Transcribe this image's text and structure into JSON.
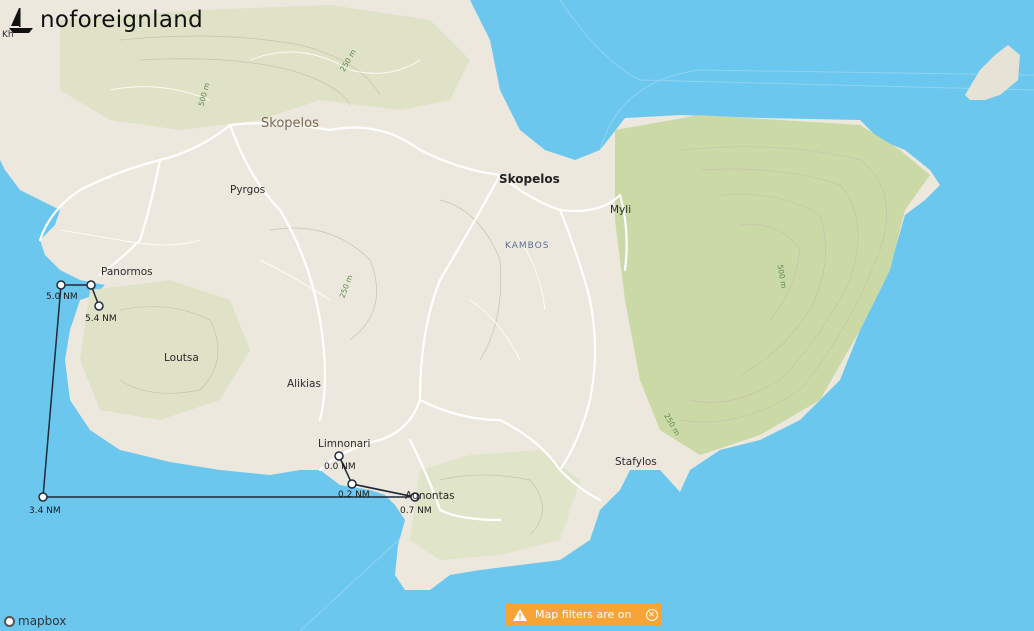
{
  "brand": {
    "name": "noforeignland",
    "partial_label": "Kh"
  },
  "labels": {
    "skopelos_island": "Skopelos",
    "skopelos_town": "Skopelos",
    "kambos": "KAMBOS",
    "mylia": "Myli",
    "pyrgos": "Pyrgos",
    "panormos": "Panormos",
    "loutsa": "Loutsa",
    "alikias": "Alikias",
    "limnonari": "Limnonari",
    "agnontas": "Agnontas",
    "stafylos": "Stafylos"
  },
  "contours": {
    "c1": "250 m",
    "c2": "500 m",
    "c3": "250 m",
    "c4": "500 m",
    "c5": "250 m"
  },
  "route": {
    "distances": {
      "d0": "0.0 NM",
      "d1": "0.2 NM",
      "d2": "0.7 NM",
      "d3": "3.4 NM",
      "d4": "5.0 NM",
      "d5": "5.4 NM"
    }
  },
  "filters_banner": {
    "label": "Map filters are on"
  },
  "attribution": {
    "label": "mapbox"
  },
  "colors": {
    "sea": "#6cc7ee",
    "land": "#ece8dd",
    "forest": "#cfdcae",
    "roads": "#ffffff",
    "route": "#1f2a3a",
    "banner": "#f6a436"
  }
}
